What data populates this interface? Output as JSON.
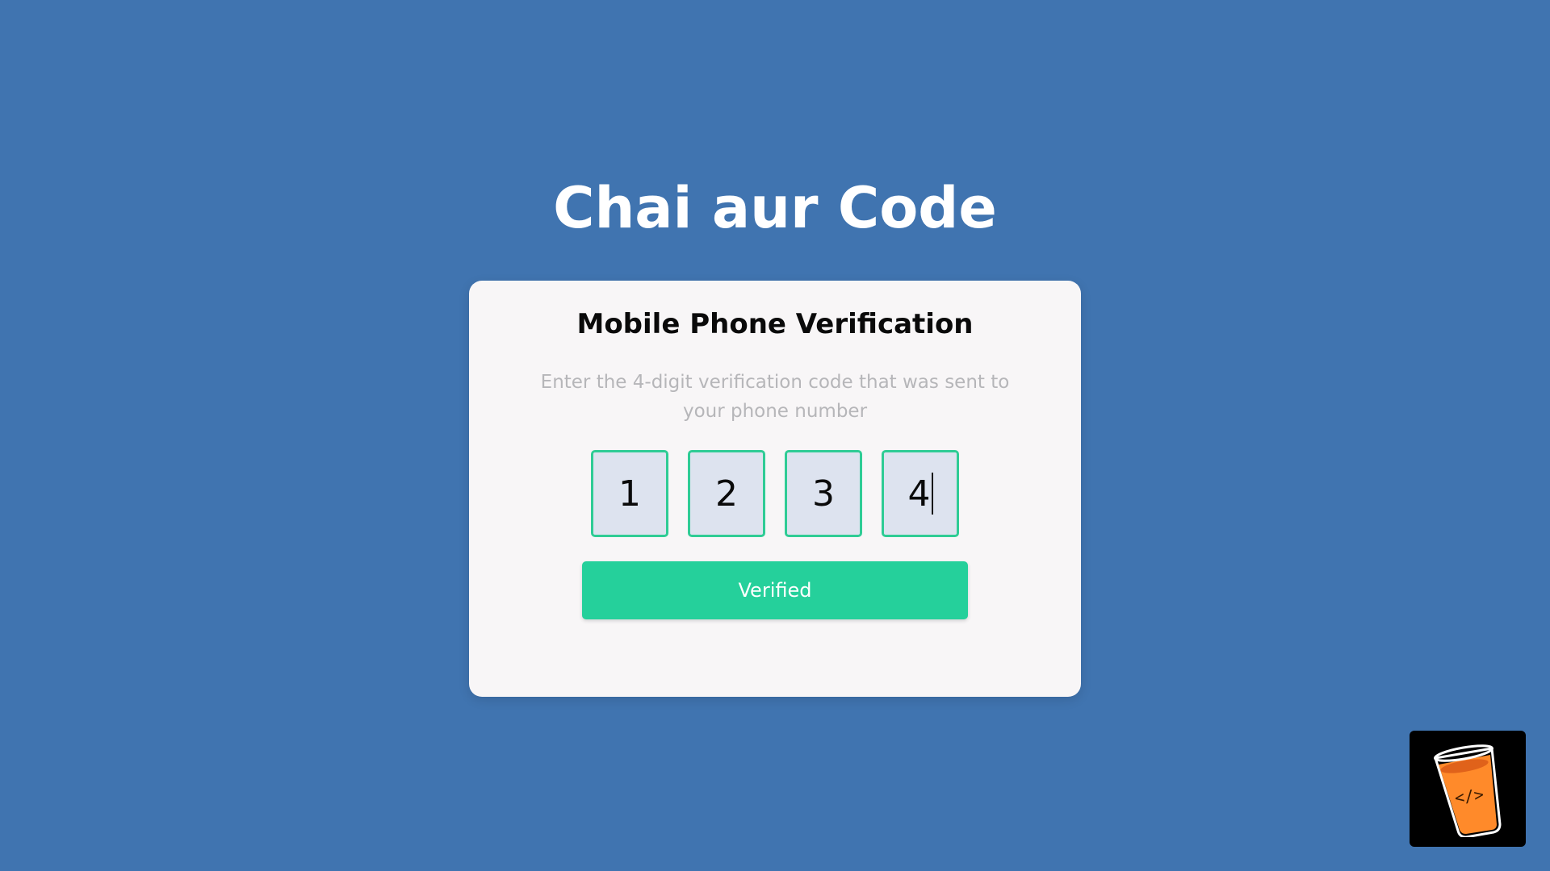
{
  "page": {
    "title": "Chai aur Code",
    "background_color": "#4074b0"
  },
  "card": {
    "title": "Mobile Phone Verification",
    "description": "Enter the 4-digit verification code that was sent to your phone number",
    "otp_digits": [
      "1",
      "2",
      "3",
      "4"
    ],
    "focused_digit_index": 3,
    "button_label": "Verified",
    "accent_color": "#25d09b",
    "input_bg_color": "#dde3ef"
  },
  "logo": {
    "icon": "chai-glass-code-icon",
    "symbol": "</>"
  }
}
